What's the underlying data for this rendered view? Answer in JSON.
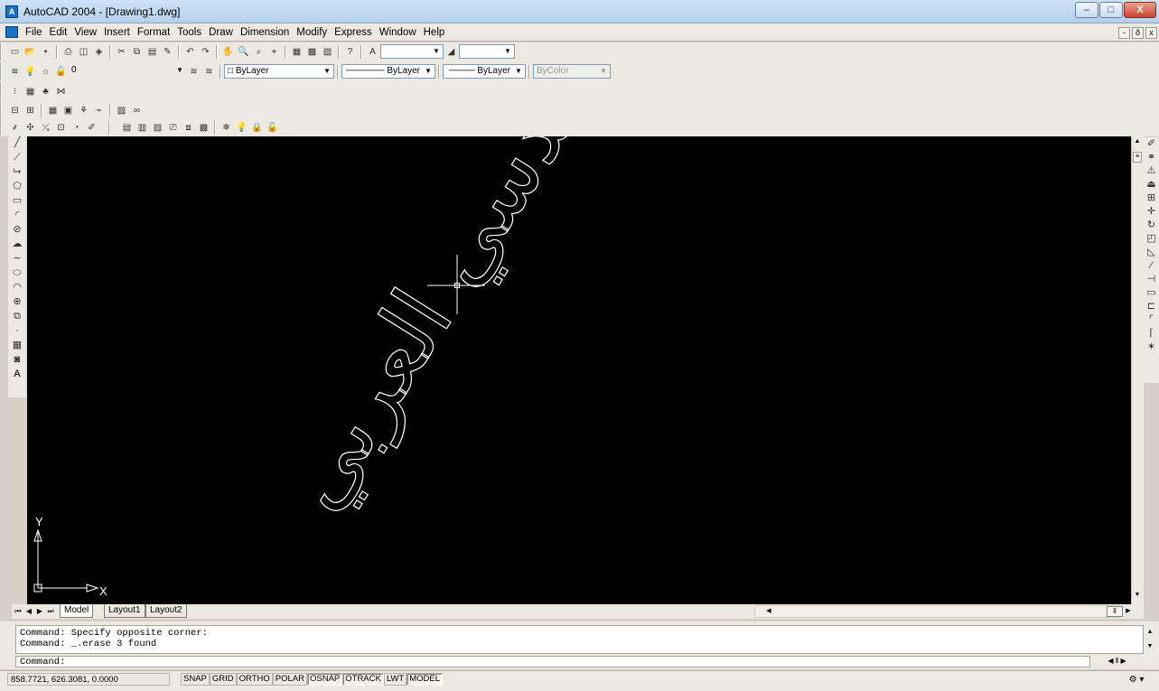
{
  "window": {
    "title": "AutoCAD 2004 - [Drawing1.dwg]",
    "app_icon_glyph": "A",
    "minimize": "–",
    "maximize": "□",
    "close": "X"
  },
  "menubar": {
    "items": [
      "File",
      "Edit",
      "View",
      "Insert",
      "Format",
      "Tools",
      "Draw",
      "Dimension",
      "Modify",
      "Express",
      "Window",
      "Help"
    ],
    "mdi": {
      "minimize": "-",
      "restore": "ð",
      "close": "x"
    }
  },
  "toolbars": {
    "layer_combo": "0",
    "color_combo": "ByLayer",
    "linetype_combo": "ByLayer",
    "lineweight_combo": "ByLayer",
    "plotstyle_combo": "ByColor"
  },
  "drawing": {
    "ucs_x_label": "X",
    "ucs_y_label": "Y",
    "watermark": "الهندسي العربي"
  },
  "tabs": [
    "Model",
    "Layout1",
    "Layout2"
  ],
  "command": {
    "history": [
      "Command: Specify opposite corner:",
      "Command: _.erase 3 found"
    ],
    "prompt": "Command:"
  },
  "status": {
    "coordinates": "858.7721, 626.3081, 0.0000",
    "buttons": [
      {
        "label": "SNAP",
        "on": false
      },
      {
        "label": "GRID",
        "on": false
      },
      {
        "label": "ORTHO",
        "on": false
      },
      {
        "label": "POLAR",
        "on": false
      },
      {
        "label": "OSNAP",
        "on": true
      },
      {
        "label": "OTRACK",
        "on": true
      },
      {
        "label": "LWT",
        "on": false
      },
      {
        "label": "MODEL",
        "on": true
      }
    ]
  }
}
